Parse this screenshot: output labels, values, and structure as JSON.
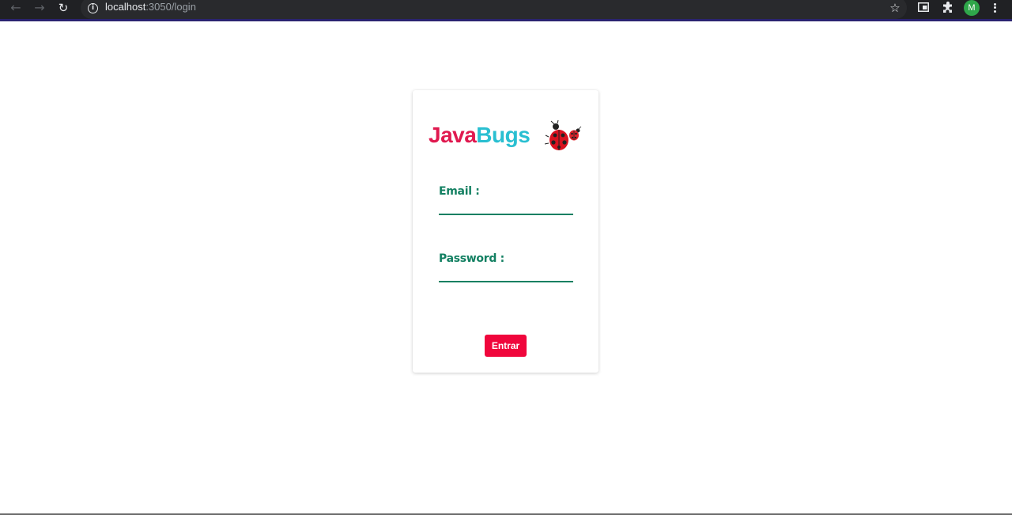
{
  "browser": {
    "back_glyph": "←",
    "forward_glyph": "→",
    "reload_glyph": "↻",
    "info_glyph": "i",
    "url_host": "localhost",
    "url_rest": ":3050/login",
    "star_glyph": "☆",
    "profile_initial": "M",
    "icons": [
      "back-arrow-icon",
      "forward-arrow-icon",
      "reload-icon",
      "info-icon",
      "star-icon",
      "tab-search-icon",
      "extensions-icon",
      "profile-avatar",
      "menu-icon"
    ]
  },
  "login": {
    "logo_java": "Java",
    "logo_bugs": "Bugs",
    "email_label": "Email :",
    "email_value": "",
    "password_label": "Password :",
    "password_value": "",
    "submit_label": "Entrar"
  },
  "colors": {
    "java": "#e0194f",
    "bugs": "#29bfd1",
    "field_accent": "#138062",
    "button": "#f0063c",
    "browser_bar": "#202124"
  }
}
